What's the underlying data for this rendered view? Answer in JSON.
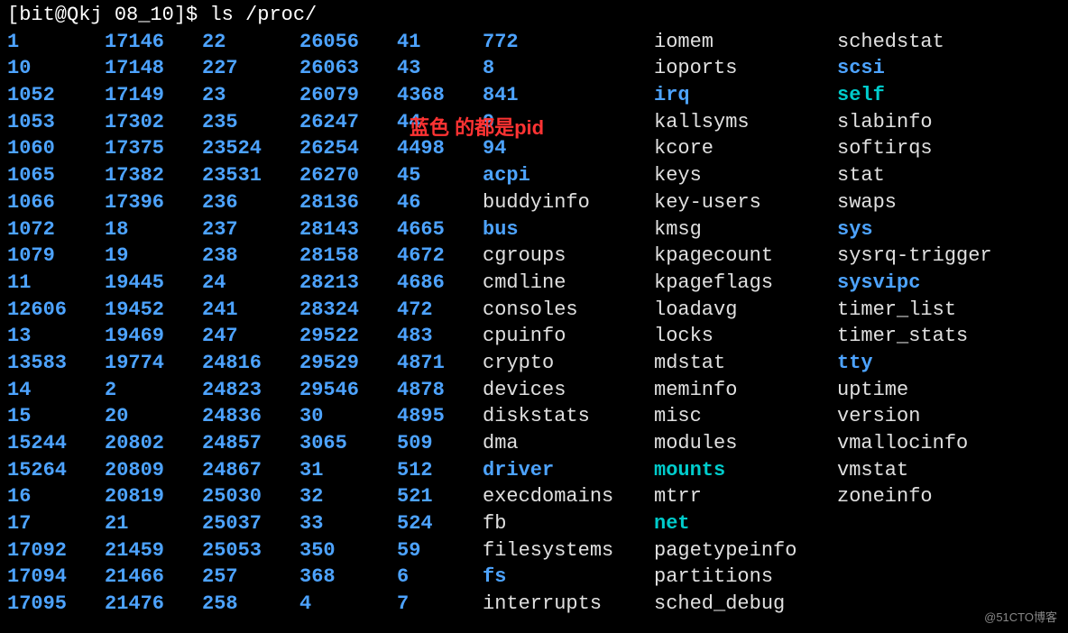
{
  "prompt": "[bit@Qkj 08_10]$ ",
  "command": "ls /proc/",
  "annotation": "蓝色 的都是pid",
  "watermark": "@51CTO博客",
  "columns": [
    [
      {
        "text": "1",
        "color": "blue"
      },
      {
        "text": "10",
        "color": "blue"
      },
      {
        "text": "1052",
        "color": "blue"
      },
      {
        "text": "1053",
        "color": "blue"
      },
      {
        "text": "1060",
        "color": "blue"
      },
      {
        "text": "1065",
        "color": "blue"
      },
      {
        "text": "1066",
        "color": "blue"
      },
      {
        "text": "1072",
        "color": "blue"
      },
      {
        "text": "1079",
        "color": "blue"
      },
      {
        "text": "11",
        "color": "blue"
      },
      {
        "text": "12606",
        "color": "blue"
      },
      {
        "text": "13",
        "color": "blue"
      },
      {
        "text": "13583",
        "color": "blue"
      },
      {
        "text": "14",
        "color": "blue"
      },
      {
        "text": "15",
        "color": "blue"
      },
      {
        "text": "15244",
        "color": "blue"
      },
      {
        "text": "15264",
        "color": "blue"
      },
      {
        "text": "16",
        "color": "blue"
      },
      {
        "text": "17",
        "color": "blue"
      },
      {
        "text": "17092",
        "color": "blue"
      },
      {
        "text": "17094",
        "color": "blue"
      },
      {
        "text": "17095",
        "color": "blue"
      }
    ],
    [
      {
        "text": "17146",
        "color": "blue"
      },
      {
        "text": "17148",
        "color": "blue"
      },
      {
        "text": "17149",
        "color": "blue"
      },
      {
        "text": "17302",
        "color": "blue"
      },
      {
        "text": "17375",
        "color": "blue"
      },
      {
        "text": "17382",
        "color": "blue"
      },
      {
        "text": "17396",
        "color": "blue"
      },
      {
        "text": "18",
        "color": "blue"
      },
      {
        "text": "19",
        "color": "blue"
      },
      {
        "text": "19445",
        "color": "blue"
      },
      {
        "text": "19452",
        "color": "blue"
      },
      {
        "text": "19469",
        "color": "blue"
      },
      {
        "text": "19774",
        "color": "blue"
      },
      {
        "text": "2",
        "color": "blue"
      },
      {
        "text": "20",
        "color": "blue"
      },
      {
        "text": "20802",
        "color": "blue"
      },
      {
        "text": "20809",
        "color": "blue"
      },
      {
        "text": "20819",
        "color": "blue"
      },
      {
        "text": "21",
        "color": "blue"
      },
      {
        "text": "21459",
        "color": "blue"
      },
      {
        "text": "21466",
        "color": "blue"
      },
      {
        "text": "21476",
        "color": "blue"
      }
    ],
    [
      {
        "text": "22",
        "color": "blue"
      },
      {
        "text": "227",
        "color": "blue"
      },
      {
        "text": "23",
        "color": "blue"
      },
      {
        "text": "235",
        "color": "blue"
      },
      {
        "text": "23524",
        "color": "blue"
      },
      {
        "text": "23531",
        "color": "blue"
      },
      {
        "text": "236",
        "color": "blue"
      },
      {
        "text": "237",
        "color": "blue"
      },
      {
        "text": "238",
        "color": "blue"
      },
      {
        "text": "24",
        "color": "blue"
      },
      {
        "text": "241",
        "color": "blue"
      },
      {
        "text": "247",
        "color": "blue"
      },
      {
        "text": "24816",
        "color": "blue"
      },
      {
        "text": "24823",
        "color": "blue"
      },
      {
        "text": "24836",
        "color": "blue"
      },
      {
        "text": "24857",
        "color": "blue"
      },
      {
        "text": "24867",
        "color": "blue"
      },
      {
        "text": "25030",
        "color": "blue"
      },
      {
        "text": "25037",
        "color": "blue"
      },
      {
        "text": "25053",
        "color": "blue"
      },
      {
        "text": "257",
        "color": "blue"
      },
      {
        "text": "258",
        "color": "blue"
      }
    ],
    [
      {
        "text": "26056",
        "color": "blue"
      },
      {
        "text": "26063",
        "color": "blue"
      },
      {
        "text": "26079",
        "color": "blue"
      },
      {
        "text": "26247",
        "color": "blue"
      },
      {
        "text": "26254",
        "color": "blue"
      },
      {
        "text": "26270",
        "color": "blue"
      },
      {
        "text": "28136",
        "color": "blue"
      },
      {
        "text": "28143",
        "color": "blue"
      },
      {
        "text": "28158",
        "color": "blue"
      },
      {
        "text": "28213",
        "color": "blue"
      },
      {
        "text": "28324",
        "color": "blue"
      },
      {
        "text": "29522",
        "color": "blue"
      },
      {
        "text": "29529",
        "color": "blue"
      },
      {
        "text": "29546",
        "color": "blue"
      },
      {
        "text": "30",
        "color": "blue"
      },
      {
        "text": "3065",
        "color": "blue"
      },
      {
        "text": "31",
        "color": "blue"
      },
      {
        "text": "32",
        "color": "blue"
      },
      {
        "text": "33",
        "color": "blue"
      },
      {
        "text": "350",
        "color": "blue"
      },
      {
        "text": "368",
        "color": "blue"
      },
      {
        "text": "4",
        "color": "blue"
      }
    ],
    [
      {
        "text": "41",
        "color": "blue"
      },
      {
        "text": "43",
        "color": "blue"
      },
      {
        "text": "4368",
        "color": "blue"
      },
      {
        "text": "44",
        "color": "blue"
      },
      {
        "text": "4498",
        "color": "blue"
      },
      {
        "text": "45",
        "color": "blue"
      },
      {
        "text": "46",
        "color": "blue"
      },
      {
        "text": "4665",
        "color": "blue"
      },
      {
        "text": "4672",
        "color": "blue"
      },
      {
        "text": "4686",
        "color": "blue"
      },
      {
        "text": "472",
        "color": "blue"
      },
      {
        "text": "483",
        "color": "blue"
      },
      {
        "text": "4871",
        "color": "blue"
      },
      {
        "text": "4878",
        "color": "blue"
      },
      {
        "text": "4895",
        "color": "blue"
      },
      {
        "text": "509",
        "color": "blue"
      },
      {
        "text": "512",
        "color": "blue"
      },
      {
        "text": "521",
        "color": "blue"
      },
      {
        "text": "524",
        "color": "blue"
      },
      {
        "text": "59",
        "color": "blue"
      },
      {
        "text": "6",
        "color": "blue"
      },
      {
        "text": "7",
        "color": "blue"
      }
    ],
    [
      {
        "text": "772",
        "color": "blue"
      },
      {
        "text": "8",
        "color": "blue"
      },
      {
        "text": "841",
        "color": "blue"
      },
      {
        "text": "9",
        "color": "blue"
      },
      {
        "text": "94",
        "color": "blue"
      },
      {
        "text": "acpi",
        "color": "blue"
      },
      {
        "text": "buddyinfo",
        "color": "white"
      },
      {
        "text": "bus",
        "color": "blue"
      },
      {
        "text": "cgroups",
        "color": "white"
      },
      {
        "text": "cmdline",
        "color": "white"
      },
      {
        "text": "consoles",
        "color": "white"
      },
      {
        "text": "cpuinfo",
        "color": "white"
      },
      {
        "text": "crypto",
        "color": "white"
      },
      {
        "text": "devices",
        "color": "white"
      },
      {
        "text": "diskstats",
        "color": "white"
      },
      {
        "text": "dma",
        "color": "white"
      },
      {
        "text": "driver",
        "color": "blue"
      },
      {
        "text": "execdomains",
        "color": "white"
      },
      {
        "text": "fb",
        "color": "white"
      },
      {
        "text": "filesystems",
        "color": "white"
      },
      {
        "text": "fs",
        "color": "blue"
      },
      {
        "text": "interrupts",
        "color": "white"
      }
    ],
    [
      {
        "text": "iomem",
        "color": "white"
      },
      {
        "text": "ioports",
        "color": "white"
      },
      {
        "text": "irq",
        "color": "blue"
      },
      {
        "text": "kallsyms",
        "color": "white"
      },
      {
        "text": "kcore",
        "color": "white"
      },
      {
        "text": "keys",
        "color": "white"
      },
      {
        "text": "key-users",
        "color": "white"
      },
      {
        "text": "kmsg",
        "color": "white"
      },
      {
        "text": "kpagecount",
        "color": "white"
      },
      {
        "text": "kpageflags",
        "color": "white"
      },
      {
        "text": "loadavg",
        "color": "white"
      },
      {
        "text": "locks",
        "color": "white"
      },
      {
        "text": "mdstat",
        "color": "white"
      },
      {
        "text": "meminfo",
        "color": "white"
      },
      {
        "text": "misc",
        "color": "white"
      },
      {
        "text": "modules",
        "color": "white"
      },
      {
        "text": "mounts",
        "color": "cyan"
      },
      {
        "text": "mtrr",
        "color": "white"
      },
      {
        "text": "net",
        "color": "cyan"
      },
      {
        "text": "pagetypeinfo",
        "color": "white"
      },
      {
        "text": "partitions",
        "color": "white"
      },
      {
        "text": "sched_debug",
        "color": "white"
      }
    ],
    [
      {
        "text": "schedstat",
        "color": "white"
      },
      {
        "text": "scsi",
        "color": "blue"
      },
      {
        "text": "self",
        "color": "cyan"
      },
      {
        "text": "slabinfo",
        "color": "white"
      },
      {
        "text": "softirqs",
        "color": "white"
      },
      {
        "text": "stat",
        "color": "white"
      },
      {
        "text": "swaps",
        "color": "white"
      },
      {
        "text": "sys",
        "color": "blue"
      },
      {
        "text": "sysrq-trigger",
        "color": "white"
      },
      {
        "text": "sysvipc",
        "color": "blue"
      },
      {
        "text": "timer_list",
        "color": "white"
      },
      {
        "text": "timer_stats",
        "color": "white"
      },
      {
        "text": "tty",
        "color": "blue"
      },
      {
        "text": "uptime",
        "color": "white"
      },
      {
        "text": "version",
        "color": "white"
      },
      {
        "text": "vmallocinfo",
        "color": "white"
      },
      {
        "text": "vmstat",
        "color": "white"
      },
      {
        "text": "zoneinfo",
        "color": "white"
      }
    ]
  ]
}
